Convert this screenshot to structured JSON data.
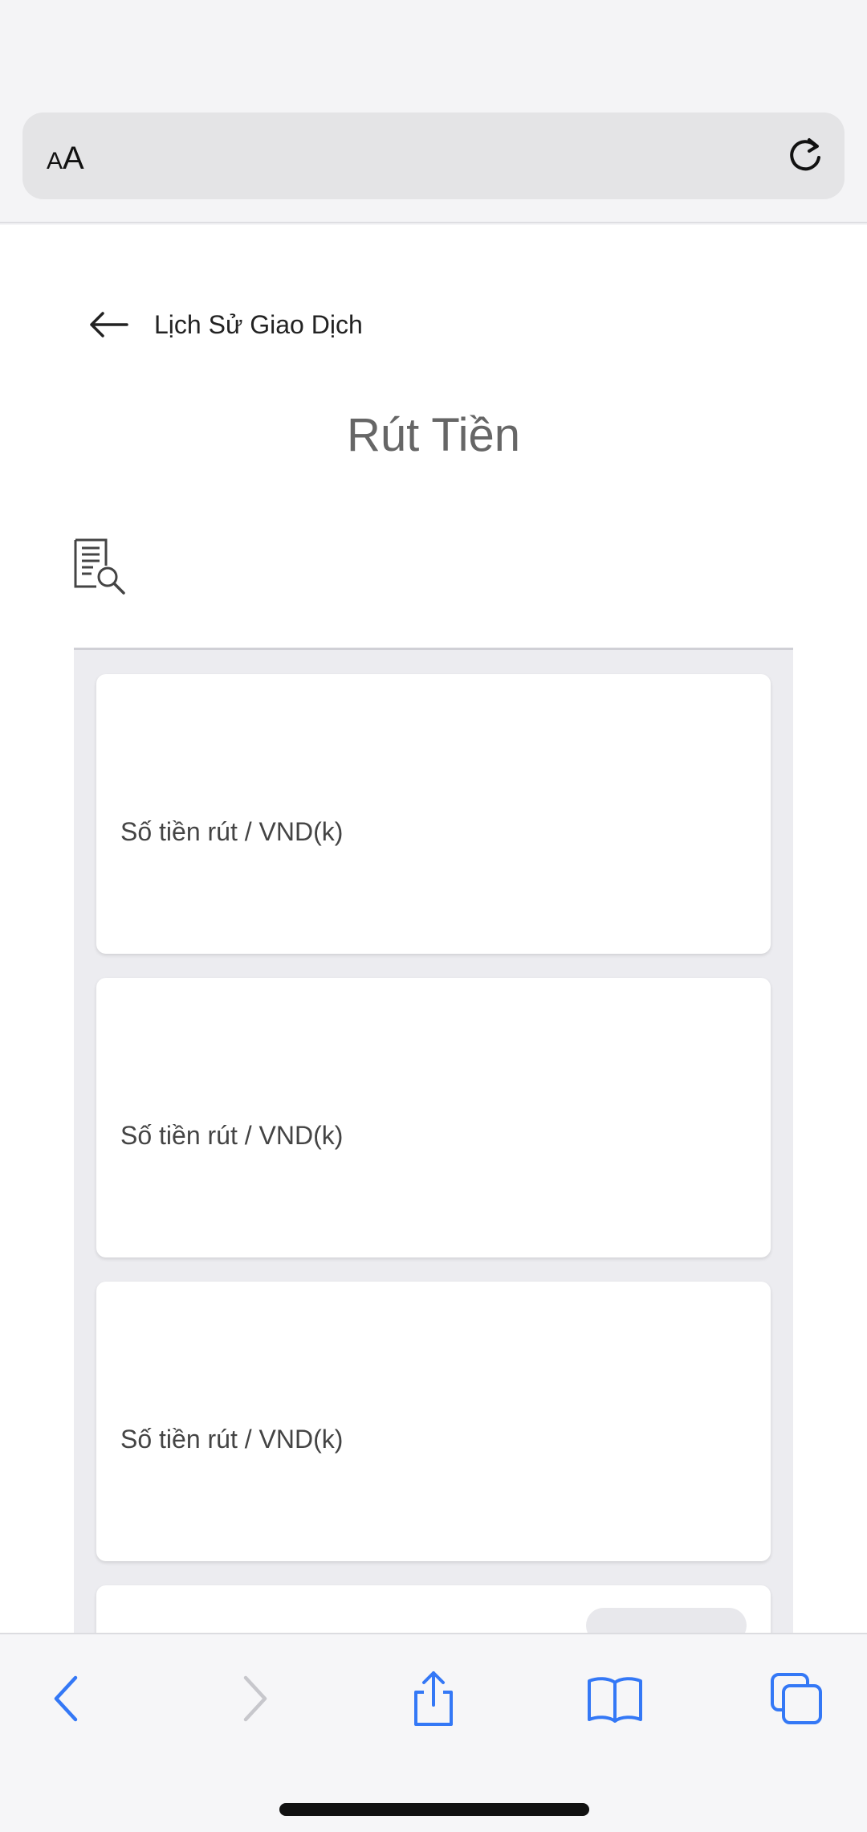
{
  "browser": {
    "text_size_button": {
      "small": "A",
      "large": "A"
    }
  },
  "page": {
    "back_label": "Lịch Sử Giao Dịch",
    "title": "Rút Tiền"
  },
  "transactions": [
    {
      "label": "Số tiền rút / VND(k)"
    },
    {
      "label": "Số tiền rút / VND(k)"
    },
    {
      "label": "Số tiền rút / VND(k)"
    }
  ],
  "colors": {
    "toolbar_blue": "#3478f6",
    "toolbar_disabled": "#c7c7cc"
  }
}
